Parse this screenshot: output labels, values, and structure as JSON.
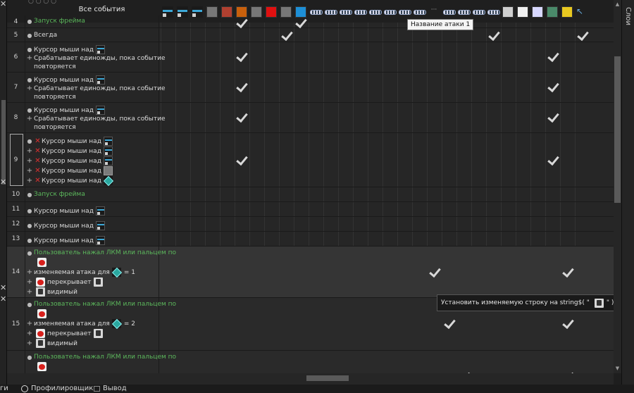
{
  "header": {
    "all_events": "Все события",
    "dots": "○ ○ ○ ○"
  },
  "right_panel": {
    "title": "Слои"
  },
  "tooltip_attack": "Название атаки 1",
  "tooltip_string": {
    "prefix": "Установить изменяемую строку на string$( \"",
    "suffix": "\" )"
  },
  "rows": [
    {
      "num": "4",
      "lines": [
        "Запуск фрейма"
      ]
    },
    {
      "num": "5",
      "lines": [
        "Всегда"
      ]
    },
    {
      "num": "6",
      "lines": [
        "Курсор мыши над",
        "Срабатывает единожды, пока событие",
        "повторяется"
      ]
    },
    {
      "num": "7",
      "lines": [
        "Курсор мыши над",
        "Срабатывает единожды, пока событие",
        "повторяется"
      ]
    },
    {
      "num": "8",
      "lines": [
        "Курсор мыши над",
        "Срабатывает единожды, пока событие",
        "повторяется"
      ]
    },
    {
      "num": "9",
      "lines": [
        "Курсор мыши над",
        "Курсор мыши над",
        "Курсор мыши над",
        "Курсор мыши над",
        "Курсор мыши над"
      ]
    },
    {
      "num": "10",
      "lines": [
        "Запуск фрейма"
      ]
    },
    {
      "num": "11",
      "lines": [
        "Курсор мыши над"
      ]
    },
    {
      "num": "12",
      "lines": [
        "Курсор мыши над"
      ]
    },
    {
      "num": "13",
      "lines": [
        "Курсор мыши над"
      ]
    },
    {
      "num": "14",
      "lines": [
        "Пользователь нажал ЛКМ или пальцем по",
        "изменяемая атака для",
        "= 1",
        "перекрывает",
        "видимый"
      ]
    },
    {
      "num": "15",
      "lines": [
        "Пользователь нажал ЛКМ или пальцем по",
        "изменяемая атака для",
        "= 2",
        "перекрывает",
        "видимый"
      ]
    },
    {
      "num": "",
      "lines": [
        "Пользователь нажал ЛКМ или пальцем по"
      ]
    }
  ],
  "bottom": {
    "left_stub": "ги",
    "profiler": "Профилировщик",
    "output": "Вывод"
  },
  "icons": [
    "bar-icon",
    "bar-icon",
    "bar-icon",
    "grey-square-icon",
    "barrel-icon",
    "orange-square-icon",
    "grey-square-icon",
    "red-square-icon",
    "grey-square-icon",
    "blue-square-icon",
    "chain-icon",
    "chain-icon",
    "chain-icon",
    "chain-icon",
    "chain-icon",
    "chain-icon",
    "chain-icon",
    "chain-icon",
    "dots-icon",
    "chain-icon",
    "chain-icon",
    "chain-icon",
    "chain-icon",
    "robot-icon",
    "apple-icon",
    "crystal-icon",
    "mountain-icon",
    "yellow-flag-icon",
    "cursor-icon"
  ]
}
